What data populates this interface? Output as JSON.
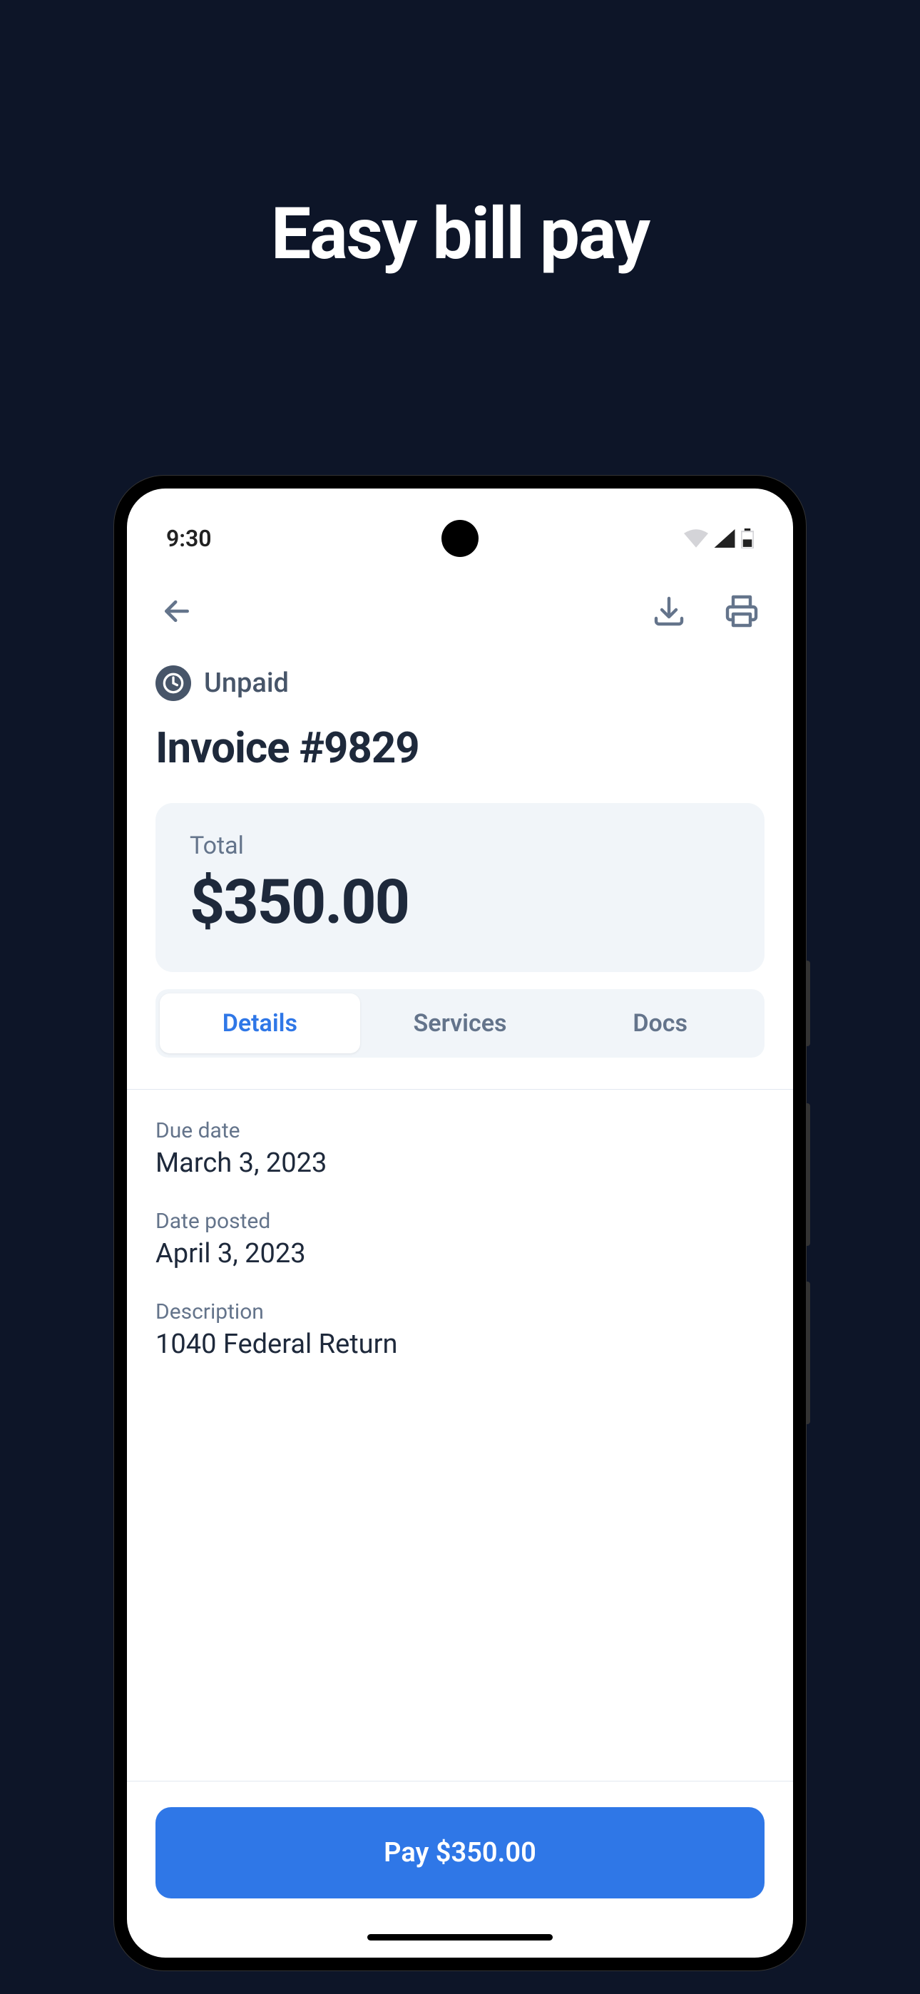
{
  "marketing": {
    "headline": "Easy bill pay"
  },
  "status_bar": {
    "time": "9:30"
  },
  "invoice": {
    "status": "Unpaid",
    "title": "Invoice #9829",
    "total_label": "Total",
    "total_amount": "$350.00"
  },
  "tabs": [
    {
      "label": "Details",
      "active": true
    },
    {
      "label": "Services",
      "active": false
    },
    {
      "label": "Docs",
      "active": false
    }
  ],
  "details": [
    {
      "label": "Due date",
      "value": "March 3, 2023"
    },
    {
      "label": "Date posted",
      "value": "April 3, 2023"
    },
    {
      "label": "Description",
      "value": "1040 Federal Return"
    }
  ],
  "footer": {
    "pay_button": "Pay $350.00"
  }
}
